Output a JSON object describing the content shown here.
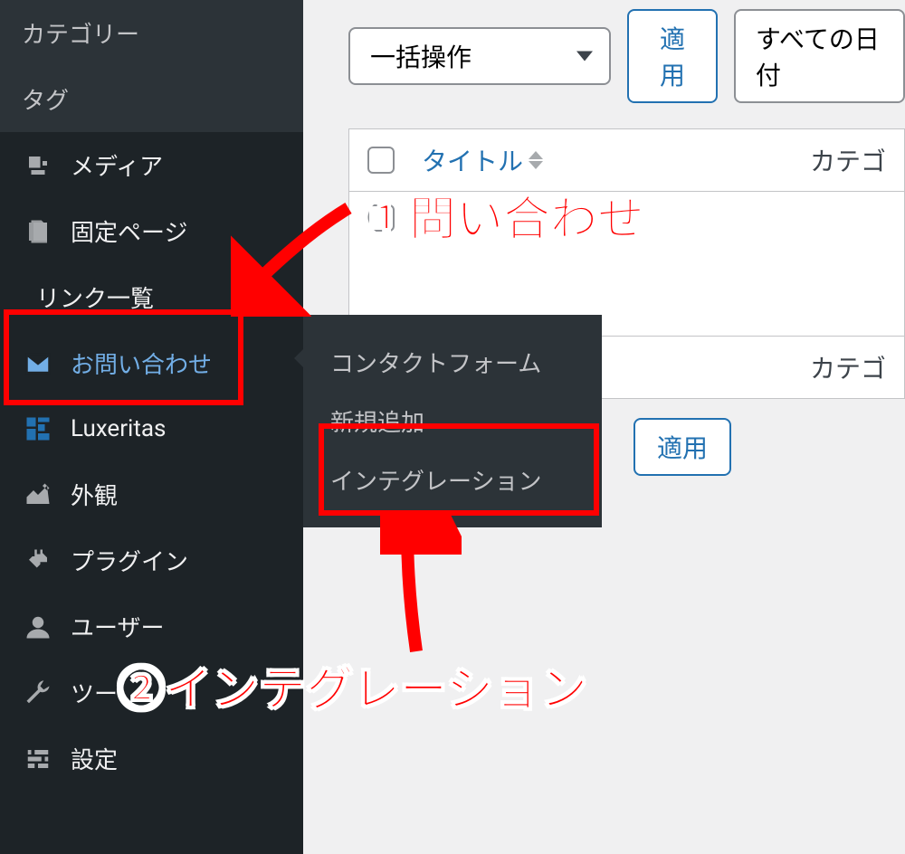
{
  "sidebar": {
    "sub_items": [
      {
        "label": "カテゴリー"
      },
      {
        "label": "タグ"
      }
    ],
    "items": [
      {
        "label": "メディア",
        "icon": "media-icon"
      },
      {
        "label": "固定ページ",
        "icon": "pages-icon"
      },
      {
        "label": "リンク一覧",
        "icon": ""
      },
      {
        "label": "お問い合わせ",
        "icon": "mail-icon",
        "active": true
      },
      {
        "label": "Luxeritas",
        "icon": "luxeritas-icon"
      },
      {
        "label": "外観",
        "icon": "appearance-icon"
      },
      {
        "label": "プラグイン",
        "icon": "plugins-icon"
      },
      {
        "label": "ユーザー",
        "icon": "users-icon"
      },
      {
        "label": "ツー",
        "icon": "tools-icon"
      },
      {
        "label": "設定",
        "icon": "settings-icon"
      }
    ]
  },
  "submenu": {
    "items": [
      {
        "label": "コンタクトフォーム"
      },
      {
        "label": "新規追加"
      },
      {
        "label": "インテグレーション"
      }
    ]
  },
  "toolbar": {
    "bulk_action_label": "一括操作",
    "apply_label": "適用",
    "date_filter_label": "すべての日付"
  },
  "table": {
    "col_title": "タイトル",
    "col_category": "カテゴ"
  },
  "annotations": {
    "a1": "①問い合わせ",
    "a2": "②インテグレーション"
  }
}
